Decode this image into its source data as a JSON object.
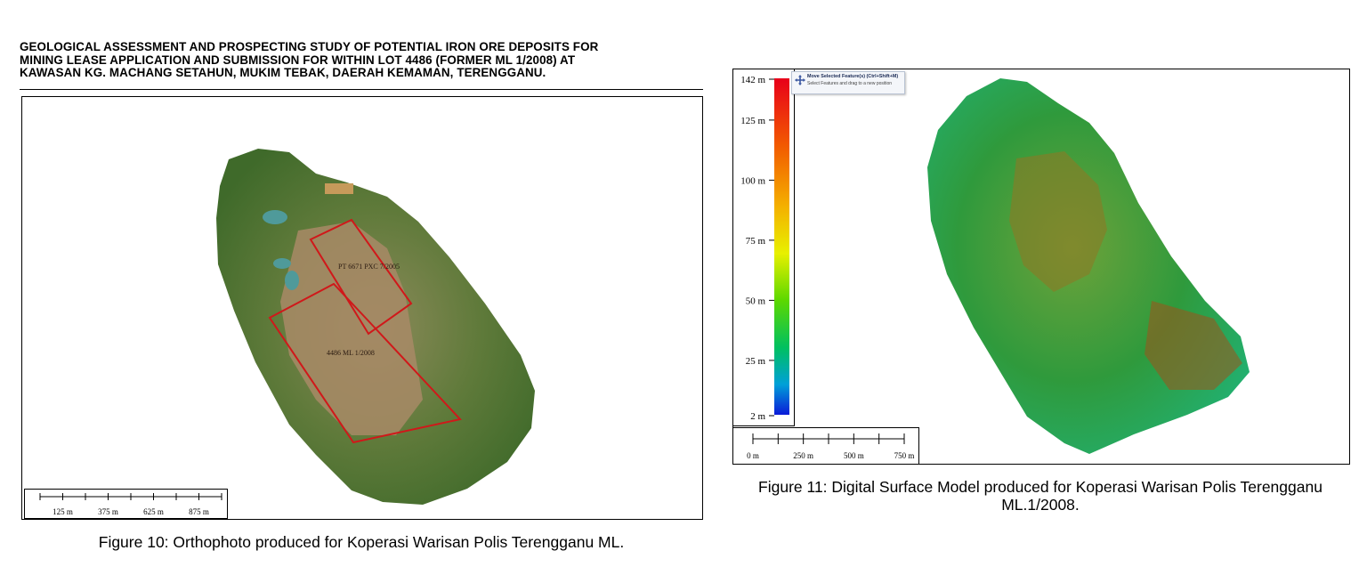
{
  "header": {
    "line1": "GEOLOGICAL ASSESSMENT AND PROSPECTING STUDY OF POTENTIAL IRON ORE DEPOSITS FOR",
    "line2": "MINING LEASE APPLICATION AND SUBMISSION FOR WITHIN LOT 4486 (FORMER ML 1/2008) AT",
    "line3": "KAWASAN KG. MACHANG SETAHUN, MUKIM TEBAK, DAERAH KEMAMAN, TERENGGANU."
  },
  "figure10": {
    "caption": "Figure 10: Orthophoto produced for Koperasi Warisan Polis Terengganu ML.",
    "plot_labels": {
      "upper": "PT 6671 PXC 7/2005",
      "lower": "4486 ML 1/2008"
    },
    "scale_ticks": [
      "125 m",
      "375 m",
      "625 m",
      "875 m"
    ],
    "boundary_color": "#d0181a"
  },
  "figure11": {
    "caption_line1": "Figure 11: Digital Surface Model produced for Koperasi Warisan Polis Terengganu",
    "caption_line2": "ML.1/2008.",
    "legend_ticks": [
      "142 m",
      "125 m",
      "100 m",
      "75 m",
      "50 m",
      "25 m",
      "2 m"
    ],
    "legend_values": [
      142,
      125,
      100,
      75,
      50,
      25,
      2
    ],
    "scale_ticks": [
      "0 m",
      "250 m",
      "500 m",
      "750 m"
    ],
    "tooltip": {
      "title": "Move Selected Feature(s) (Ctrl+Shift+M)",
      "description": "Select Features and drag to a new position"
    }
  }
}
